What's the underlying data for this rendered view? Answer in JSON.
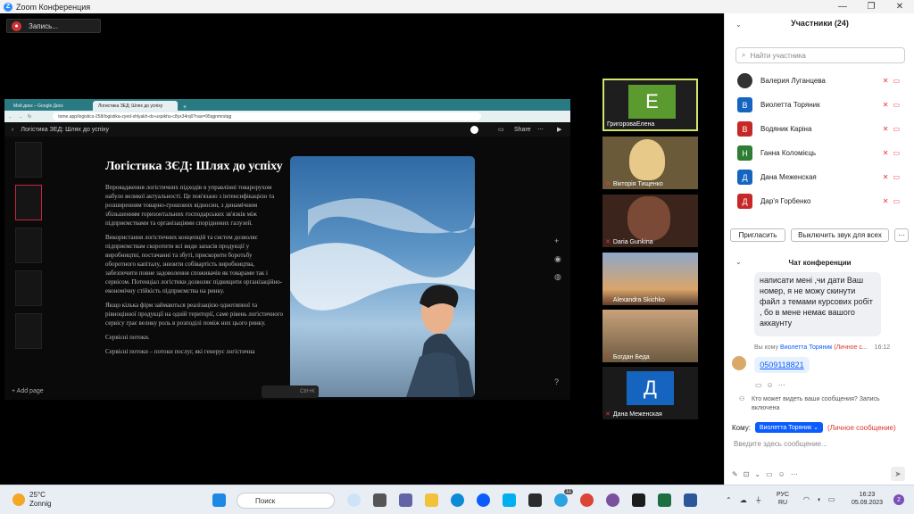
{
  "window": {
    "title": "Zoom Конференция"
  },
  "recording": {
    "label": "Запись..."
  },
  "browser": {
    "tabs": [
      "Мой диск – Google Диск",
      "Логистика ЗЕД: Шлях до успіху"
    ],
    "url": "tome.app/logistics-258/logistika-zyed-shlyakh-do-uspikhu-c8yx34rq0?nav=95qgnmrstqg",
    "doc_title": "Логістика ЗЕД: Шлях до успіху",
    "share": "Share",
    "add_page": "Add page",
    "badge": "Ctrl+K"
  },
  "slide": {
    "title": "Логістика ЗЄД: Шлях до успіху",
    "paragraphs": [
      "Впровадження логістичних підходів в управлінні товарорухом набуло великої актуальності. Це пов'язано з інтенсифікацією та розширенням товарно-грошових відносин, з динамічним збільшенням горизонтальних господарських зв'язків між підприємствами та організаціями споріднених галузей.",
      "Використання логістичних концепцій та систем дозволяє підприємствам скоротити всі види запасів продукції у виробництві, постачанні та збуті, прискорити боротьбу оборотного капіталу, знизити собівартість виробництва, забезпечити повне задоволення споживачів як товарами так і сервісом. Потенціал логістики дозволяє підвищити організаційно-економічну стійкість підприємства на ринку.",
      "Якщо кілька фірм займаються реалізацією однотипної та рівноцінної продукції на одній території, саме рівень логістичного сервісу грає велику роль в розподілі поміж них цього ринку.",
      "Сервісні потоки.",
      "Сервісні потоки – потоки послуг, які генерує логістична"
    ]
  },
  "videos": [
    {
      "name": "ГригороваЕлена",
      "letter": "Е",
      "color": "#5b9a2f",
      "muted": false
    },
    {
      "name": "Вікторія Тищенко",
      "letter": "",
      "color": "#8a6a4a",
      "muted": true
    },
    {
      "name": "Daria Gunkina",
      "letter": "",
      "color": "#4a3024",
      "muted": true
    },
    {
      "name": "Alexandra Skichko",
      "letter": "",
      "color": "#3b4a6a",
      "muted": true
    },
    {
      "name": "Богдан Беда",
      "letter": "",
      "color": "#5a4e3c",
      "muted": true
    },
    {
      "name": "Дана Меженская",
      "letter": "Д",
      "color": "#1565c0",
      "muted": true
    }
  ],
  "participants": {
    "header": "Участники (24)",
    "search_placeholder": "Найти участника",
    "items": [
      {
        "name": "Валерия Луганцева",
        "letter": "",
        "color": "#333333"
      },
      {
        "name": "Виолетта Торяник",
        "letter": "В",
        "color": "#1565c0"
      },
      {
        "name": "Водяник Каріна",
        "letter": "В",
        "color": "#c62828"
      },
      {
        "name": "Ганна Коломієць",
        "letter": "Н",
        "color": "#2e7d32"
      },
      {
        "name": "Дана Меженская",
        "letter": "Д",
        "color": "#1565c0"
      },
      {
        "name": "Дар'я Горбенко",
        "letter": "Д",
        "color": "#c62828"
      }
    ],
    "invite": "Пригласить",
    "mute_all": "Выключить звук для всех",
    "more": "···"
  },
  "chat": {
    "header": "Чат конференции",
    "message": "написати мені ,чи дати Ваш номер, я не можу скинути файл з темами курсових робіт , бо в мене немає вашого аккаунту",
    "meta_prefix": "Вы кому",
    "meta_to": "Виолетта Торяник",
    "meta_private": "(Личное с...",
    "meta_time": "16:12",
    "phone": "0509118821",
    "visibility_note": "Кто может видеть ваши сообщения? Запись включена",
    "to_label": "Кому:",
    "to_recipient": "Виолетта Торяник",
    "to_private": "(Личное сообщение)",
    "input_placeholder": "Введите здесь сообщение..."
  },
  "taskbar": {
    "temp": "25°C",
    "weather": "Zonnig",
    "search": "Поиск",
    "lang": "РУС",
    "lang2": "RU",
    "time": "16:23",
    "date": "05.09.2023",
    "notif": "2",
    "badge": "11"
  }
}
